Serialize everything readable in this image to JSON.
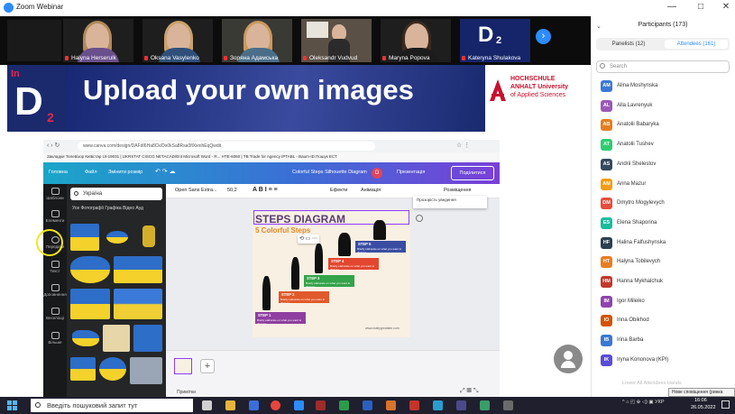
{
  "window": {
    "title": "Zoom Webinar",
    "minimize": "—",
    "maximize": "□",
    "close": "✕"
  },
  "gallery": {
    "participants": [
      {
        "name": "Halyna Herserulk"
      },
      {
        "name": "Oksana Vasylenko"
      },
      {
        "name": "Зоряна Адамська"
      },
      {
        "name": "Oleksandr Vudvud"
      },
      {
        "name": "Maryna Popova"
      },
      {
        "name": "Kateryna Shulakova"
      }
    ],
    "next_icon": "chevron-right-icon"
  },
  "banner": {
    "title": "Upload your own images",
    "logo_text": "InD2",
    "hs_lines": [
      "HOCHSCHULE",
      "ANHALT University",
      "of Applied Sciences"
    ]
  },
  "canva": {
    "url": "www.canva.com/design/DAFdI6Ha8Ck/Dx0kSa8Rsa0flXxnihEqQwdit",
    "bookmarks": "Закладки  Телевізор Київстар  UI-19031 | UKRSTAT  CISCO NETACAD/Ent  Microsoft Word - R...  НТЕ-6060 | TB  Trade for Agency  IPTABL - Baum-ID  Пошук ЕСТ",
    "home": "Головна",
    "file": "Файл",
    "resize": "Змінити розмір",
    "doc_title": "Colorful Steps Silhouette Diagram",
    "avatar_letter": "О",
    "present": "Презентація",
    "share": "Поділитися",
    "rail": [
      "Шаблони",
      "Елементи",
      "Передати",
      "Текст",
      "Доповнення",
      "Веселощі",
      "Більше"
    ],
    "search_value": "Україна",
    "media_tabs": "Усе   Фотографії   Графіка   Відео   Ауд",
    "toolbar_font": "Open Sans Extra...",
    "toolbar_size": "50,2",
    "toolbar_effects": "Ефекти",
    "toolbar_animate": "Анімація",
    "toolbar_position": "Розміщення",
    "tooltip": "Прозорість уведення",
    "pages_label": "Примітки",
    "add_page": "+"
  },
  "slide": {
    "title": "STEPS DIAGRAM",
    "subtitle": "5 Colorful Steps",
    "steps": [
      {
        "label": "STEP 1",
        "text": "Briefly elaborate on what you want to discuss.",
        "color": "#8e3fa0"
      },
      {
        "label": "STEP 2",
        "text": "Briefly elaborate on what you want to discuss.",
        "color": "#e05a2b"
      },
      {
        "label": "STEP 3",
        "text": "Briefly elaborate on what you want to discuss.",
        "color": "#34a34a"
      },
      {
        "label": "STEP 4",
        "text": "Briefly elaborate on what you want to discuss.",
        "color": "#e3462f"
      },
      {
        "label": "STEP 5",
        "text": "Briefly elaborate on what you want to discuss.",
        "color": "#3b4da3"
      }
    ],
    "footer": "www.reallygreatsite.com"
  },
  "participants": {
    "title": "Participants (173)",
    "tab_panelists": "Panelists (12)",
    "tab_attendees": "Attendees (161)",
    "search_placeholder": "Search",
    "list": [
      {
        "initials": "AM",
        "name": "Alina Moshynska",
        "color": "#3a78d6"
      },
      {
        "initials": "AL",
        "name": "Alla Lavrenyuk",
        "color": "#9b59b6"
      },
      {
        "initials": "AB",
        "name": "Anatolii Babaryka",
        "color": "#e67e22"
      },
      {
        "initials": "AT",
        "name": "Anatolii Tushev",
        "color": "#2ecc71"
      },
      {
        "initials": "AS",
        "name": "Andrii Shelestov",
        "color": "#34495e"
      },
      {
        "initials": "AM",
        "name": "Anna Mazur",
        "color": "#f39c12"
      },
      {
        "initials": "DM",
        "name": "Dmytro Mogylevych",
        "color": "#e74c3c"
      },
      {
        "initials": "ES",
        "name": "Elena Shaporina",
        "color": "#1abc9c"
      },
      {
        "initials": "HF",
        "name": "Halina Falfushynska",
        "color": "#2c3e50"
      },
      {
        "initials": "HT",
        "name": "Halyna Tobilevych",
        "color": "#e67e22"
      },
      {
        "initials": "HM",
        "name": "Hanna Mykhalchuk",
        "color": "#c0392b"
      },
      {
        "initials": "IM",
        "name": "Igor Mileiko",
        "color": "#8e44ad"
      },
      {
        "initials": "IO",
        "name": "Inna Obikhod",
        "color": "#d35400"
      },
      {
        "initials": "IB",
        "name": "Irina Barba",
        "color": "#3a78d6"
      },
      {
        "initials": "IK",
        "name": "Iryna Kononova (KPI)",
        "color": "#5b4bd6"
      }
    ],
    "lower_hands": "Lower All Attendees Hands",
    "tooltip": "Нове сповіщення (ринка"
  },
  "taskbar": {
    "search_placeholder": "Введіть пошуковий запит тут",
    "tray": "^ ⌂ ◰ ⊕ ◁) ▣ УКР",
    "time": "16:06",
    "date": "26.05.2022"
  }
}
